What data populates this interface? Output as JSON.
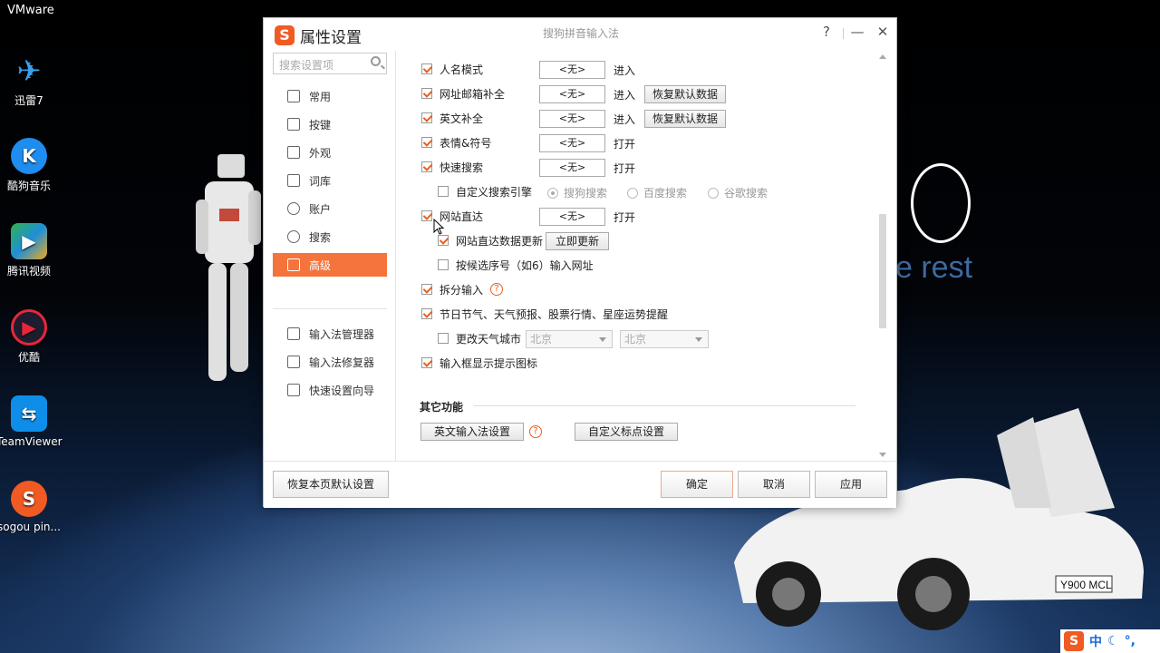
{
  "desktop": {
    "vmware_label": "VMware",
    "icons": [
      {
        "label": "迅雷7",
        "glyph": "✈",
        "color": "#1b7fd6"
      },
      {
        "label": "酷狗音乐",
        "glyph": "K",
        "color": "#1f8cf0"
      },
      {
        "label": "腾讯视频",
        "glyph": "▶",
        "color": "#2fb24c"
      },
      {
        "label": "优酷",
        "glyph": "▶",
        "color": "#e8263a"
      },
      {
        "label": "TeamViewer",
        "glyph": "⇆",
        "color": "#0e8ee9"
      },
      {
        "label": "sogou pin...",
        "glyph": "S",
        "color": "#f15a22"
      }
    ],
    "wallpaper_zero": "0",
    "wallpaper_text": "e rest",
    "tray": {
      "ime_logo": "S",
      "lang": "中",
      "moon": "☾",
      "punct": "°,"
    }
  },
  "dialog": {
    "logo_glyph": "S",
    "title": "属性设置",
    "subtitle": "搜狗拼音输入法",
    "help_btn": "?",
    "minimize_btn": "—",
    "close_btn": "✕",
    "search_placeholder": "搜索设置项",
    "nav": [
      {
        "label": "常用",
        "icon": "monitor-icon"
      },
      {
        "label": "按键",
        "icon": "keyboard-icon"
      },
      {
        "label": "外观",
        "icon": "shirt-icon"
      },
      {
        "label": "词库",
        "icon": "book-icon"
      },
      {
        "label": "账户",
        "icon": "user-icon"
      },
      {
        "label": "搜索",
        "icon": "search-icon"
      },
      {
        "label": "高级",
        "icon": "advanced-icon",
        "active": true
      }
    ],
    "tools": [
      {
        "label": "输入法管理器",
        "icon": "list-icon"
      },
      {
        "label": "输入法修复器",
        "icon": "repair-icon"
      },
      {
        "label": "快速设置向导",
        "icon": "flag-icon"
      }
    ],
    "settings": {
      "name_mode": {
        "label": "人名模式",
        "checked": true,
        "key": "<无>",
        "action": "进入"
      },
      "email_complete": {
        "label": "网址邮箱补全",
        "checked": true,
        "key": "<无>",
        "action": "进入",
        "restore": "恢复默认数据"
      },
      "english_complete": {
        "label": "英文补全",
        "checked": true,
        "key": "<无>",
        "action": "进入",
        "restore": "恢复默认数据"
      },
      "emoji": {
        "label": "表情&符号",
        "checked": true,
        "key": "<无>",
        "action": "打开"
      },
      "quick_search": {
        "label": "快速搜索",
        "checked": true,
        "key": "<无>",
        "action": "打开"
      },
      "custom_engine": {
        "label": "自定义搜索引擎",
        "checked": false
      },
      "engines": [
        {
          "label": "搜狗搜索",
          "selected": true
        },
        {
          "label": "百度搜索",
          "selected": false
        },
        {
          "label": "谷歌搜索",
          "selected": false
        }
      ],
      "site_direct": {
        "label": "网站直达",
        "checked": true,
        "key": "<无>",
        "action": "打开"
      },
      "site_data_update": {
        "label": "网站直达数据更新",
        "checked": true,
        "button": "立即更新"
      },
      "candidate_url": {
        "label": "按候选序号（如6）输入网址",
        "checked": false
      },
      "split_input": {
        "label": "拆分输入",
        "checked": true,
        "help": "?"
      },
      "holiday_info": {
        "label": "节日节气、天气预报、股票行情、星座运势提醒",
        "checked": true
      },
      "change_city": {
        "label": "更改天气城市",
        "checked": false,
        "province": "北京",
        "city": "北京"
      },
      "input_box_icon": {
        "label": "输入框显示提示图标",
        "checked": true
      }
    },
    "other_section_title": "其它功能",
    "english_ime_settings": "英文输入法设置",
    "other_help": "?",
    "custom_punct_settings": "自定义标点设置",
    "footer": {
      "restore_page": "恢复本页默认设置",
      "ok": "确定",
      "cancel": "取消",
      "apply": "应用"
    }
  },
  "colors": {
    "accent": "#f4743b",
    "check": "#e8601c"
  }
}
